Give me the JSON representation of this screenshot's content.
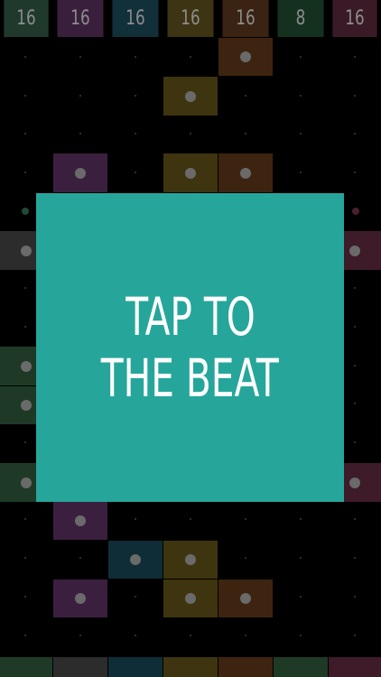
{
  "header": {
    "tiles": [
      {
        "value": "16",
        "color": "#1f3a2c"
      },
      {
        "value": "16",
        "color": "#3a1f3d"
      },
      {
        "value": "16",
        "color": "#12303a"
      },
      {
        "value": "16",
        "color": "#3d3413"
      },
      {
        "value": "16",
        "color": "#3a2312"
      },
      {
        "value": "8",
        "color": "#14311f"
      },
      {
        "value": "16",
        "color": "#3a1a26"
      }
    ]
  },
  "overlay": {
    "line1": "TAP TO",
    "line2": "THE BEAT",
    "color": "#26a69a"
  },
  "pad_colors": {
    "green": "#1e3a26",
    "purple": "#3b1f3f",
    "teal": "#0f2d36",
    "olive": "#3e3410",
    "orange": "#3d2410",
    "rose": "#3d1b28",
    "grey": "#2c2c2c"
  }
}
